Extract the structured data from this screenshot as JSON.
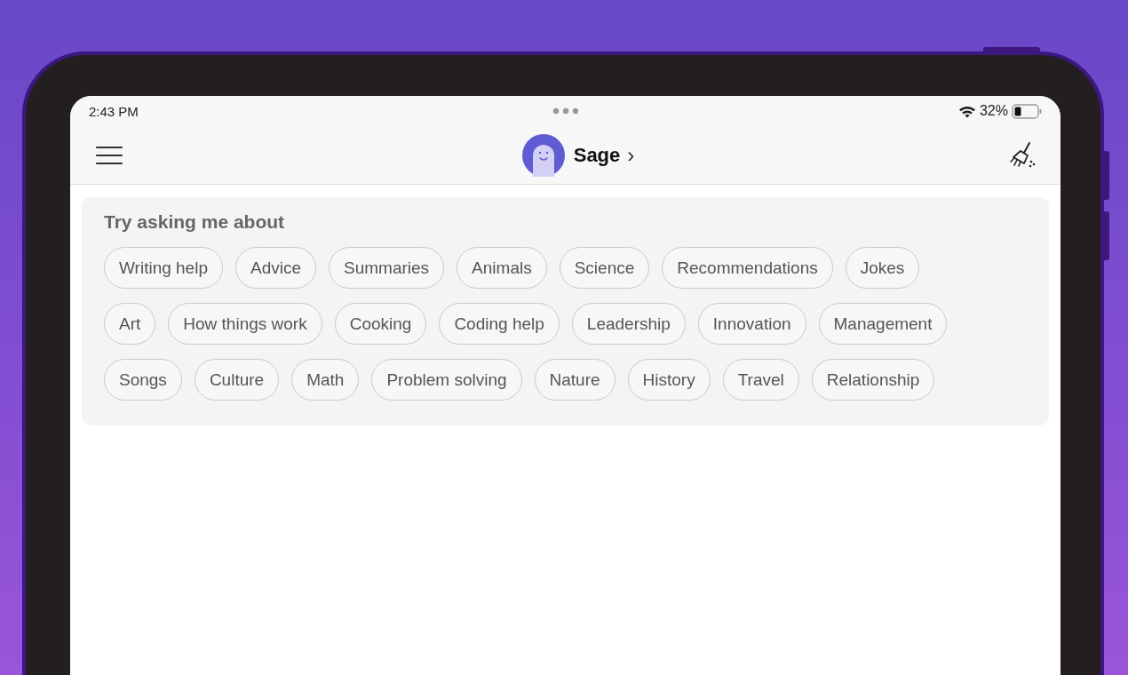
{
  "status_bar": {
    "time": "2:43 PM",
    "battery": "32%"
  },
  "header": {
    "bot_name": "Sage",
    "chevron": "›"
  },
  "suggestions": {
    "title": "Try asking me about",
    "rows": [
      {
        "chips": [
          "Writing help",
          "Advice",
          "Summaries",
          "Animals",
          "Science",
          "Recommendations",
          "Jokes"
        ]
      },
      {
        "chips": [
          "Art",
          "How things work",
          "Cooking",
          "Coding help",
          "Leadership",
          "Innovation",
          "Management"
        ]
      },
      {
        "chips": [
          "Songs",
          "Culture",
          "Math",
          "Problem solving",
          "Nature",
          "History",
          "Travel",
          "Relationship"
        ]
      }
    ]
  }
}
